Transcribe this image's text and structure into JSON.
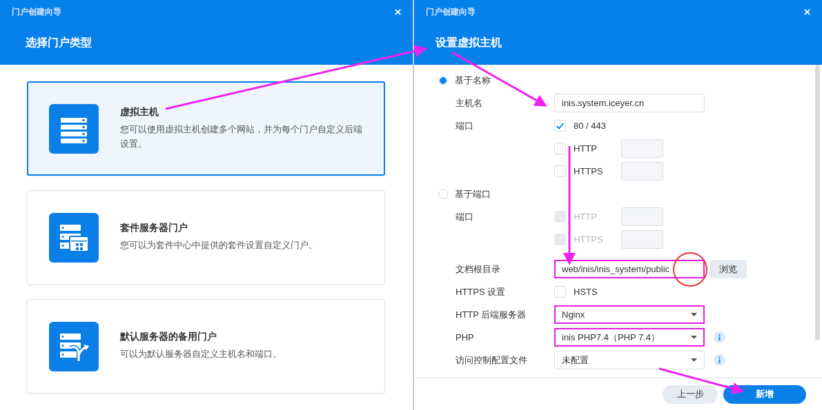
{
  "left_dialog": {
    "title": "门户创建向导",
    "heading": "选择门户类型",
    "cards": [
      {
        "kind": "server",
        "title": "虚拟主机",
        "description": "您可以使用虚拟主机创建多个网站，并为每个门户自定义后端设置。",
        "selected": true
      },
      {
        "kind": "package",
        "title": "套件服务器门户",
        "description": "您可以为套件中心中提供的套件设置自定义门户。",
        "selected": false
      },
      {
        "kind": "fallback",
        "title": "默认服务器的备用门户",
        "description": "可以为默认服务器自定义主机名和端口。",
        "selected": false
      }
    ]
  },
  "right_dialog": {
    "title": "门户创建向导",
    "heading": "设置虚拟主机",
    "rows": [
      {
        "kind": "radio",
        "label": "基于名称",
        "selected": true
      },
      {
        "kind": "text",
        "label": "主机名",
        "value": "inis.system.iceyer.cn",
        "highlighted": false
      },
      {
        "kind": "check",
        "label": "端口",
        "option": "80 / 443",
        "checked": true,
        "disabled": false
      },
      {
        "kind": "check_port",
        "option": "HTTP",
        "checked": false,
        "disabled": false
      },
      {
        "kind": "check_port",
        "option": "HTTPS",
        "checked": false,
        "disabled": false
      },
      {
        "kind": "radio",
        "label": "基于端口",
        "selected": false
      },
      {
        "kind": "check_port",
        "label": "端口",
        "option": "HTTP",
        "checked": false,
        "disabled": true
      },
      {
        "kind": "check_port",
        "option": "HTTPS",
        "checked": false,
        "disabled": true
      },
      {
        "kind": "text",
        "label": "文档根目录",
        "value": "web/inis/inis_system/public",
        "highlighted": true,
        "circled": true,
        "button": "浏览"
      },
      {
        "kind": "check",
        "label": "HTTPS 设置",
        "option": "HSTS",
        "checked": false,
        "disabled": false
      },
      {
        "kind": "select",
        "label": "HTTP 后端服务器",
        "value": "Nginx",
        "highlighted": true
      },
      {
        "kind": "select",
        "label": "PHP",
        "value": "inis PHP7.4（PHP 7.4）",
        "highlighted": true,
        "info": true
      },
      {
        "kind": "select",
        "label": "访问控制配置文件",
        "value": "未配置",
        "highlighted": false,
        "info": true
      }
    ],
    "buttons": [
      {
        "kind": "secondary",
        "label": "上一步"
      },
      {
        "kind": "primary",
        "label": "新增"
      }
    ]
  }
}
